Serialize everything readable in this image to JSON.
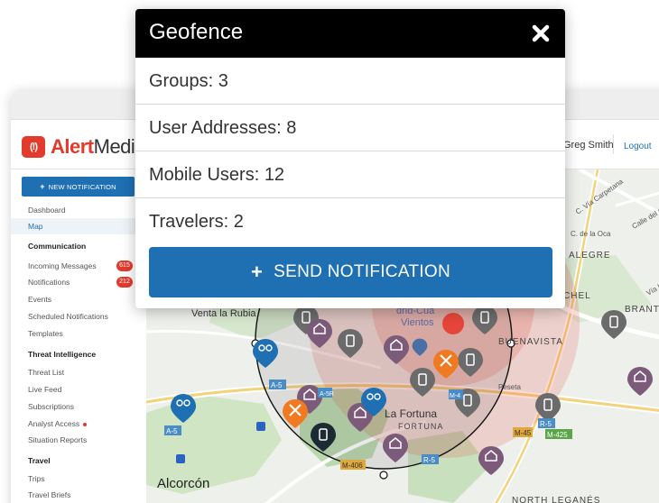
{
  "app": {
    "logo_strong": "Alert",
    "logo_rest": "Media",
    "logo_mark": "(!)",
    "user_name": "Greg Smith",
    "logout_label": "Logout"
  },
  "sidebar": {
    "new_notification_label": "NEW NOTIFICATION",
    "items": [
      {
        "label": "Dashboard"
      },
      {
        "label": "Map",
        "active": true
      }
    ],
    "communication": {
      "heading": "Communication",
      "items": [
        {
          "label": "Incoming Messages",
          "badge": "615"
        },
        {
          "label": "Notifications",
          "badge": "212"
        },
        {
          "label": "Events"
        },
        {
          "label": "Scheduled Notifications"
        },
        {
          "label": "Templates"
        }
      ]
    },
    "threat_intelligence": {
      "heading": "Threat Intelligence",
      "items": [
        {
          "label": "Threat List"
        },
        {
          "label": "Live Feed"
        },
        {
          "label": "Subscriptions"
        },
        {
          "label": "Analyst Access",
          "dot": true
        },
        {
          "label": "Situation Reports"
        }
      ]
    },
    "travel": {
      "heading": "Travel",
      "items": [
        {
          "label": "Trips"
        },
        {
          "label": "Travel Briefs"
        }
      ]
    }
  },
  "map": {
    "place_labels": [
      "Venta la Rubia",
      "BUENAVISTA",
      "ALEGRE",
      "CHEL",
      "BRANTES",
      "Alcorcón",
      "La Fortuna",
      "FORTUNA",
      "NORTH LEGANÉS",
      "Peseta",
      "C. de la Oca",
      "C. Vía Carpetana",
      "Calle del Gral.",
      "Vía Lusitana",
      "drid-Cua",
      "Vientos"
    ],
    "road_labels": [
      "A-5",
      "M-406",
      "R-5",
      "M-45",
      "M-425",
      "A-5R",
      "M-4"
    ],
    "colors": {
      "geofence": "#e6453a",
      "pin": "#6b6b6b",
      "pin_purple": "#7b5a7a",
      "pin_blue": "#1f6fb3",
      "pin_orange": "#f07a22"
    }
  },
  "modal": {
    "title": "Geofence",
    "rows": [
      {
        "label": "Groups: 3"
      },
      {
        "label": "User Addresses: 8"
      },
      {
        "label": "Mobile Users: 12"
      },
      {
        "label": "Travelers: 2"
      }
    ],
    "send_label": "SEND NOTIFICATION",
    "header_color": "#000000",
    "button_color": "#1f6fb3"
  }
}
